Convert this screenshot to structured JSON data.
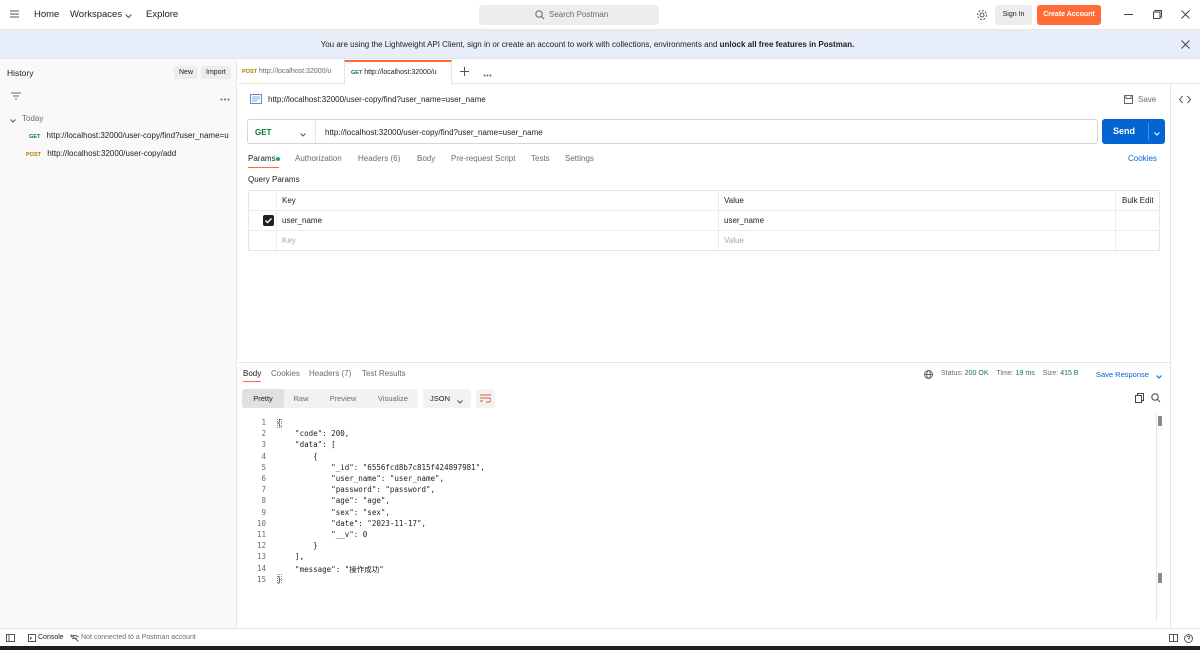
{
  "topbar": {
    "nav": [
      "Home",
      "Workspaces",
      "Explore"
    ],
    "search_placeholder": "Search Postman",
    "signin": "Sign In",
    "create_account": "Create Account"
  },
  "banner": {
    "text": "You are using the Lightweight API Client, sign in or create an account to work with collections, environments and ",
    "bold": "unlock all free features in Postman."
  },
  "sidebar": {
    "title": "History",
    "new_label": "New",
    "import_label": "Import",
    "group": "Today",
    "items": [
      {
        "method": "GET",
        "url": "http://localhost:32000/user-copy/find?user_name=u"
      },
      {
        "method": "POST",
        "url": "http://localhost:32000/user-copy/add"
      }
    ]
  },
  "tabs": [
    {
      "method": "POST",
      "label": "http://localhost:32000/u"
    },
    {
      "method": "GET",
      "label": "http://localhost:32000/u"
    }
  ],
  "request": {
    "title": "http://localhost:32000/user-copy/find?user_name=user_name",
    "save_label": "Save",
    "method": "GET",
    "url": "http://localhost:32000/user-copy/find?user_name=user_name",
    "send_label": "Send",
    "tabs": [
      "Params",
      "Authorization",
      "Headers (6)",
      "Body",
      "Pre-request Script",
      "Tests",
      "Settings"
    ],
    "cookies_label": "Cookies",
    "query_params_title": "Query Params",
    "table": {
      "headers": [
        "Key",
        "Value",
        "Bulk Edit"
      ],
      "rows": [
        {
          "key": "user_name",
          "value": "user_name"
        }
      ],
      "placeholder": {
        "key": "Key",
        "value": "Value"
      }
    }
  },
  "response": {
    "tabs": [
      "Body",
      "Cookies",
      "Headers (7)",
      "Test Results"
    ],
    "status_label": "Status:",
    "status_value": "200 OK",
    "time_label": "Time:",
    "time_value": "19 ms",
    "size_label": "Size:",
    "size_value": "415 B",
    "save_response": "Save Response",
    "formats": [
      "Pretty",
      "Raw",
      "Preview",
      "Visualize"
    ],
    "language": "JSON",
    "code_lines": [
      "{",
      "    \"code\": 200,",
      "    \"data\": [",
      "        {",
      "            \"_id\": \"6556fcd8b7c815f424897981\",",
      "            \"user_name\": \"user_name\",",
      "            \"password\": \"password\",",
      "            \"age\": \"age\",",
      "            \"sex\": \"sex\",",
      "            \"date\": \"2023-11-17\",",
      "            \"__v\": 0",
      "        }",
      "    ],",
      "    \"message\": \"操作成功\"",
      "}"
    ]
  },
  "footer": {
    "console": "Console",
    "status": "Not connected to a Postman account"
  }
}
